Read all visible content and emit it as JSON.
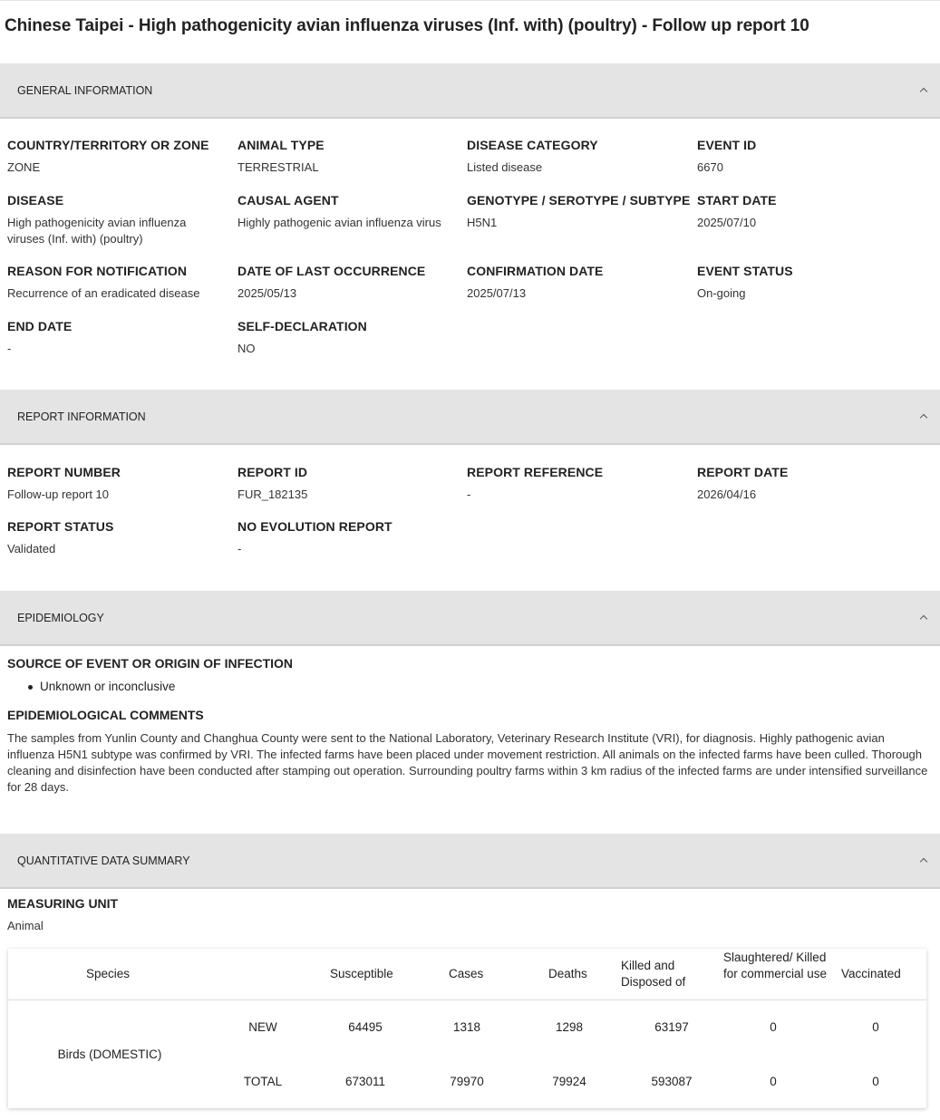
{
  "page_title": "Chinese Taipei - High pathogenicity avian influenza viruses (Inf. with) (poultry) - Follow up report 10",
  "sections": {
    "general": "GENERAL INFORMATION",
    "report": "REPORT INFORMATION",
    "epidemiology": "EPIDEMIOLOGY",
    "quantitative": "QUANTITATIVE DATA SUMMARY"
  },
  "general": [
    {
      "label": "COUNTRY/TERRITORY OR ZONE",
      "value": "ZONE"
    },
    {
      "label": "ANIMAL TYPE",
      "value": "TERRESTRIAL"
    },
    {
      "label": "DISEASE CATEGORY",
      "value": "Listed disease"
    },
    {
      "label": "EVENT ID",
      "value": "6670"
    },
    {
      "label": "DISEASE",
      "value": "High pathogenicity avian influenza viruses (Inf. with) (poultry)"
    },
    {
      "label": "CAUSAL AGENT",
      "value": "Highly pathogenic avian influenza virus"
    },
    {
      "label": "GENOTYPE / SEROTYPE / SUBTYPE",
      "value": "H5N1"
    },
    {
      "label": "START DATE",
      "value": "2025/07/10"
    },
    {
      "label": "REASON FOR NOTIFICATION",
      "value": "Recurrence of an eradicated disease"
    },
    {
      "label": "DATE OF LAST OCCURRENCE",
      "value": "2025/05/13"
    },
    {
      "label": "CONFIRMATION DATE",
      "value": "2025/07/13"
    },
    {
      "label": "EVENT STATUS",
      "value": "On-going"
    },
    {
      "label": "END DATE",
      "value": "-"
    },
    {
      "label": "SELF-DECLARATION",
      "value": "NO"
    }
  ],
  "report": [
    {
      "label": "REPORT NUMBER",
      "value": "Follow-up report 10"
    },
    {
      "label": "REPORT ID",
      "value": "FUR_182135"
    },
    {
      "label": "REPORT REFERENCE",
      "value": "-"
    },
    {
      "label": "REPORT DATE",
      "value": "2026/04/16"
    },
    {
      "label": "REPORT STATUS",
      "value": "Validated"
    },
    {
      "label": "NO EVOLUTION REPORT",
      "value": "-"
    }
  ],
  "epidemiology": {
    "source_title": "SOURCE OF EVENT OR ORIGIN OF INFECTION",
    "sources": [
      "Unknown or inconclusive"
    ],
    "comments_title": "EPIDEMIOLOGICAL COMMENTS",
    "comments": "The samples from Yunlin County and Changhua County were sent to the National Laboratory, Veterinary Research Institute (VRI), for diagnosis. Highly pathogenic avian influenza H5N1 subtype was confirmed by VRI. The infected farms have been placed under movement restriction. All animals on the infected farms have been culled. Thorough cleaning and disinfection have been conducted after stamping out operation. Surrounding poultry farms within 3 km radius of the infected farms are under intensified surveillance for 28 days."
  },
  "quantitative": {
    "measuring_unit_label": "MEASURING UNIT",
    "measuring_unit": "Animal",
    "headers": [
      "Species",
      "Susceptible",
      "Cases",
      "Deaths",
      "Killed and Disposed of",
      "Slaughtered/ Killed for commercial use",
      "Vaccinated"
    ],
    "species": "Birds (DOMESTIC)",
    "rows": [
      {
        "type": "NEW",
        "values": [
          "64495",
          "1318",
          "1298",
          "63197",
          "0",
          "0"
        ]
      },
      {
        "type": "TOTAL",
        "values": [
          "673011",
          "79970",
          "79924",
          "593087",
          "0",
          "0"
        ]
      }
    ]
  }
}
